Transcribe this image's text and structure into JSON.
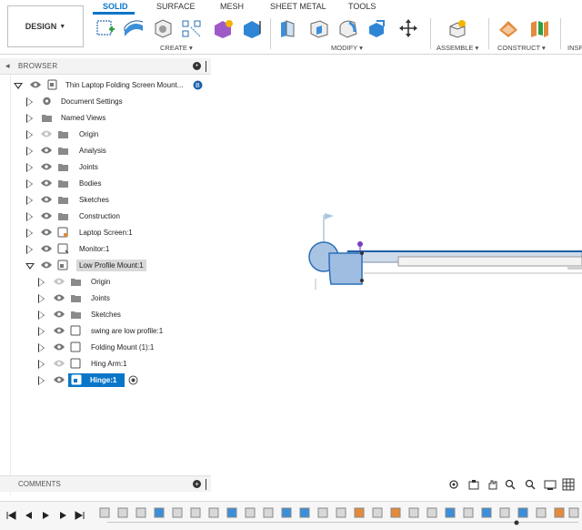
{
  "toolbar": {
    "workspace": "DESIGN",
    "tabs": [
      {
        "label": "SOLID",
        "active": true
      },
      {
        "label": "SURFACE",
        "active": false
      },
      {
        "label": "MESH",
        "active": false
      },
      {
        "label": "SHEET METAL",
        "active": false
      },
      {
        "label": "TOOLS",
        "active": false
      }
    ],
    "groups": [
      "CREATE ▾",
      "MODIFY ▾",
      "ASSEMBLE ▾",
      "CONSTRUCT ▾",
      "INSP"
    ],
    "accent": "#0a76c8"
  },
  "browser": {
    "title": "BROWSER",
    "root_label": "Thin Laptop Folding Screen Mount...",
    "items": [
      {
        "label": "Document Settings"
      },
      {
        "label": "Named Views"
      },
      {
        "label": "Origin"
      },
      {
        "label": "Analysis"
      },
      {
        "label": "Joints"
      },
      {
        "label": "Bodies"
      },
      {
        "label": "Sketches"
      },
      {
        "label": "Construction"
      },
      {
        "label": "Laptop Screen:1"
      },
      {
        "label": "Monitor:1"
      },
      {
        "label": "Low Profile Mount:1"
      },
      {
        "label": "Origin"
      },
      {
        "label": "Joints"
      },
      {
        "label": "Sketches"
      },
      {
        "label": "swing are low profile:1"
      },
      {
        "label": "Folding Mount (1):1"
      },
      {
        "label": "Hing Arm:1"
      },
      {
        "label": "Hinge:1"
      }
    ]
  },
  "comments": {
    "title": "COMMENTS"
  },
  "icons": {
    "eye": "eye-icon",
    "folder": "folder-icon",
    "gear": "gear-icon",
    "component": "component-icon",
    "radio": "radio-icon"
  }
}
